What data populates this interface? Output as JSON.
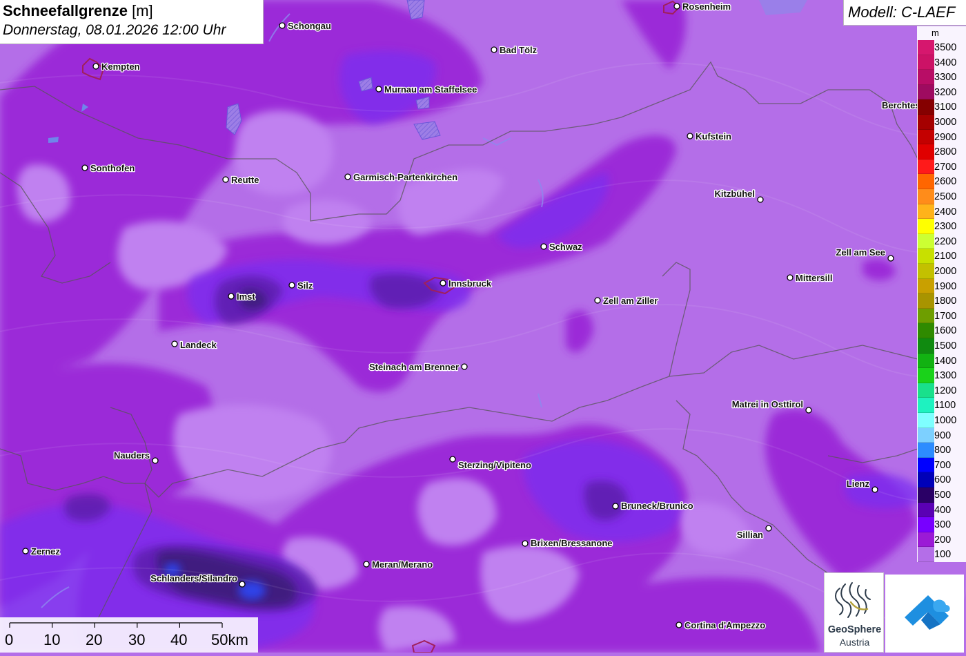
{
  "title": {
    "parameter": "Schneefallgrenze",
    "unit": "[m]",
    "datetime": "Donnerstag, 08.01.2026 12:00 Uhr"
  },
  "model": "Modell: C-LAEF",
  "legend": {
    "unit": "m",
    "entries": [
      {
        "label": "3500",
        "color": "#d6176e"
      },
      {
        "label": "3400",
        "color": "#cc1266"
      },
      {
        "label": "3300",
        "color": "#b80d66"
      },
      {
        "label": "3200",
        "color": "#9e0b60"
      },
      {
        "label": "3100",
        "color": "#850000"
      },
      {
        "label": "3000",
        "color": "#a50000"
      },
      {
        "label": "2900",
        "color": "#c40000"
      },
      {
        "label": "2800",
        "color": "#e00000"
      },
      {
        "label": "2700",
        "color": "#ff1a1a"
      },
      {
        "label": "2600",
        "color": "#ff6600"
      },
      {
        "label": "2500",
        "color": "#ff8c1a"
      },
      {
        "label": "2400",
        "color": "#ffb31a"
      },
      {
        "label": "2300",
        "color": "#ffff00"
      },
      {
        "label": "2200",
        "color": "#ccff33"
      },
      {
        "label": "2100",
        "color": "#c8e000"
      },
      {
        "label": "2000",
        "color": "#c3c000"
      },
      {
        "label": "1900",
        "color": "#c9a000"
      },
      {
        "label": "1800",
        "color": "#a89400"
      },
      {
        "label": "1700",
        "color": "#6e9e00"
      },
      {
        "label": "1600",
        "color": "#2f8a00"
      },
      {
        "label": "1500",
        "color": "#108a10"
      },
      {
        "label": "1400",
        "color": "#12b212"
      },
      {
        "label": "1300",
        "color": "#1ad21a"
      },
      {
        "label": "1200",
        "color": "#19e08c"
      },
      {
        "label": "1100",
        "color": "#1ef2c0"
      },
      {
        "label": "1000",
        "color": "#7fffff"
      },
      {
        "label": "900",
        "color": "#7dd0ff"
      },
      {
        "label": "800",
        "color": "#2d8cff"
      },
      {
        "label": "700",
        "color": "#0000ff"
      },
      {
        "label": "600",
        "color": "#0000b8"
      },
      {
        "label": "500",
        "color": "#2a0066"
      },
      {
        "label": "400",
        "color": "#5a00b4"
      },
      {
        "label": "300",
        "color": "#7800ff"
      },
      {
        "label": "200",
        "color": "#9b1ad6"
      },
      {
        "label": "100",
        "color": "#b46ee8"
      }
    ]
  },
  "cities": [
    {
      "name": "Rosenheim",
      "label_pos": "right"
    },
    {
      "name": "Schongau",
      "label_pos": "right"
    },
    {
      "name": "Kempten",
      "label_pos": "right"
    },
    {
      "name": "Bad Tölz",
      "label_pos": "right"
    },
    {
      "name": "Murnau am Staffelsee",
      "label_pos": "right"
    },
    {
      "name": "Berchtesgaden",
      "label_pos": "right"
    },
    {
      "name": "Kufstein",
      "label_pos": "right"
    },
    {
      "name": "Sonthofen",
      "label_pos": "right"
    },
    {
      "name": "Reutte",
      "label_pos": "right"
    },
    {
      "name": "Garmisch-Partenkirchen",
      "label_pos": "right"
    },
    {
      "name": "Kitzbühel",
      "label_pos": "left"
    },
    {
      "name": "Schwaz",
      "label_pos": "right"
    },
    {
      "name": "Zell am See",
      "label_pos": "left"
    },
    {
      "name": "Mittersill",
      "label_pos": "right"
    },
    {
      "name": "Innsbruck",
      "label_pos": "right"
    },
    {
      "name": "Imst",
      "label_pos": "right"
    },
    {
      "name": "Silz",
      "label_pos": "right"
    },
    {
      "name": "Zell am Ziller",
      "label_pos": "right"
    },
    {
      "name": "Landeck",
      "label_pos": "right"
    },
    {
      "name": "Steinach am Brenner",
      "label_pos": "left"
    },
    {
      "name": "Matrei in Osttirol",
      "label_pos": "left"
    },
    {
      "name": "Nauders",
      "label_pos": "left"
    },
    {
      "name": "Sterzing/Vipiteno",
      "label_pos": "right"
    },
    {
      "name": "Lienz",
      "label_pos": "left"
    },
    {
      "name": "Bruneck/Brunico",
      "label_pos": "right"
    },
    {
      "name": "Sillian",
      "label_pos": "left"
    },
    {
      "name": "Brixen/Bressanone",
      "label_pos": "right"
    },
    {
      "name": "Zernez",
      "label_pos": "right"
    },
    {
      "name": "Meran/Merano",
      "label_pos": "right"
    },
    {
      "name": "Schlanders/Silandro",
      "label_pos": "left"
    },
    {
      "name": "Cortina d'Ampezzo",
      "label_pos": "right"
    }
  ],
  "scale_bar": {
    "ticks": [
      "0",
      "10",
      "20",
      "30",
      "40"
    ],
    "last": "50km"
  },
  "logos": {
    "geosphere_line1": "GeoSphere",
    "geosphere_line2": "Austria"
  }
}
